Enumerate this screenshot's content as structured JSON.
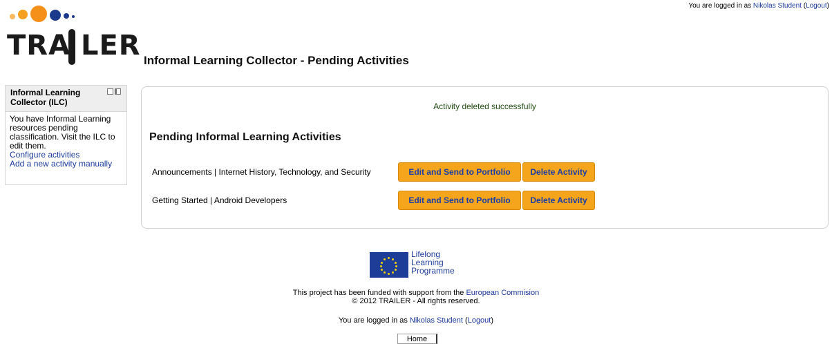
{
  "header": {
    "login_prefix": "You are logged in as ",
    "user_name": "Nikolas Student",
    "logout_label": "Logout",
    "logo_text": "TRA LER",
    "page_title": "Informal Learning Collector - Pending Activities"
  },
  "sidebar": {
    "block_title": "Informal Learning Collector (ILC)",
    "controls_icon": "hide-dock-icon",
    "message": "You have Informal Learning resources pending classification. Visit the ILC to edit them.",
    "links": [
      "Configure activities",
      "Add a new activity manually"
    ]
  },
  "main": {
    "status_message": "Activity deleted successfully",
    "section_heading": "Pending Informal Learning Activities",
    "activities": [
      {
        "name": "Announcements | Internet History, Technology, and Security",
        "edit_label": "Edit and Send to Portfolio",
        "delete_label": "Delete Activity"
      },
      {
        "name": "Getting Started | Android Developers",
        "edit_label": "Edit and Send to Portfolio",
        "delete_label": "Delete Activity"
      }
    ]
  },
  "footer": {
    "eu_logo_lines": [
      "Lifelong",
      "Learning",
      "Programme"
    ],
    "funded_prefix": "This project has been funded with support from the ",
    "funded_link": "European Commision",
    "copyright": "© 2012 TRAILER - All rights reserved.",
    "login_prefix": "You are logged in as ",
    "user_name": "Nikolas Student",
    "logout_label": "Logout",
    "home_label": "Home"
  },
  "colors": {
    "button_bg": "#f5a51b",
    "button_text": "#1b3ea8",
    "link": "#1a3a9c",
    "eu_blue": "#1e3d99",
    "logo_orange": "#f5a020",
    "logo_blue": "#1c3a8c"
  }
}
